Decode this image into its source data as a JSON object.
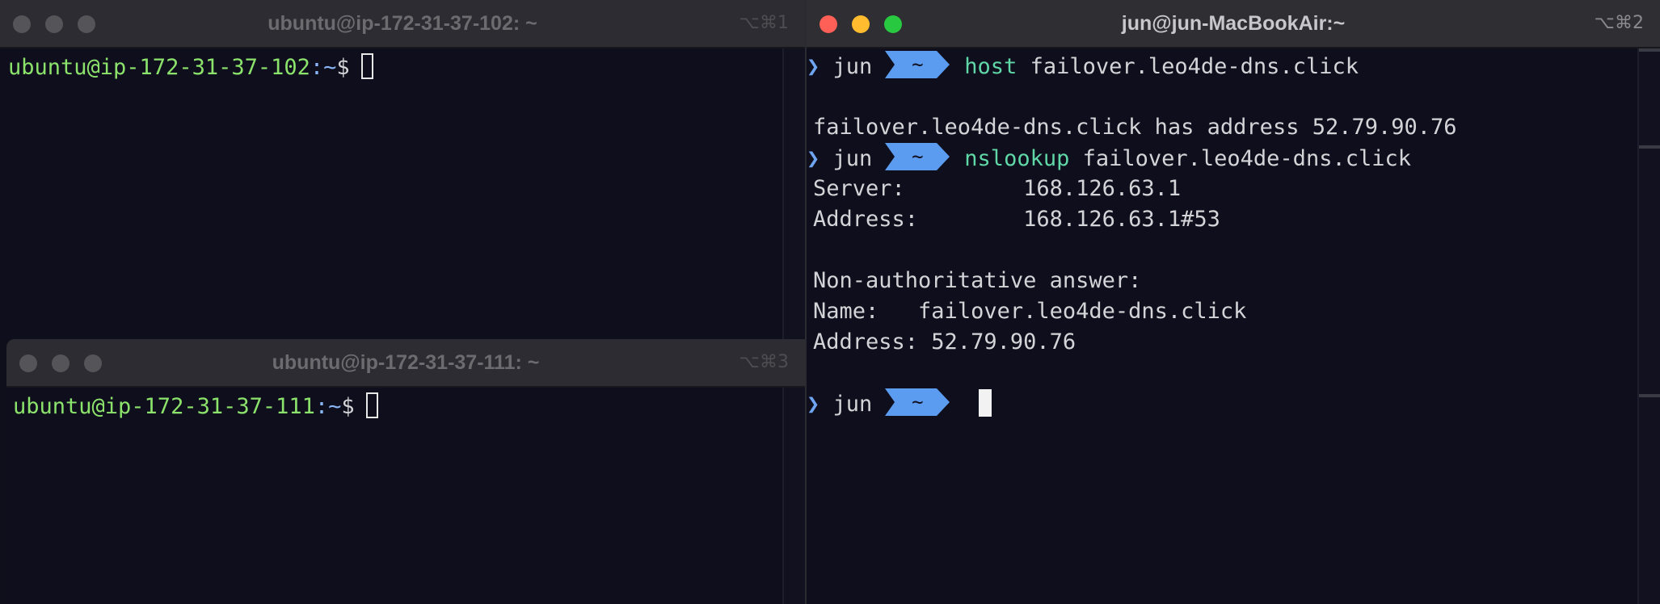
{
  "windows": {
    "top_left": {
      "title": "ubuntu@ip-172-31-37-102: ~",
      "shortcut": "⌥⌘1",
      "prompt_user": "ubuntu@ip-172-31-37-102",
      "prompt_path": ":~",
      "prompt_symbol": "$"
    },
    "bottom_left": {
      "title": "ubuntu@ip-172-31-37-111: ~",
      "shortcut": "⌥⌘3",
      "prompt_user": "ubuntu@ip-172-31-37-111",
      "prompt_path": ":~",
      "prompt_symbol": "$"
    },
    "right": {
      "title": "jun@jun-MacBookAir:~",
      "shortcut": "⌥⌘2",
      "prompt": {
        "user": "jun",
        "dir": "~"
      },
      "lines": [
        {
          "type": "prompt",
          "cmd": "host",
          "args": "failover.leo4de-dns.click"
        },
        {
          "type": "blank"
        },
        {
          "type": "out",
          "text": "failover.leo4de-dns.click has address 52.79.90.76"
        },
        {
          "type": "prompt",
          "cmd": "nslookup",
          "args": "failover.leo4de-dns.click"
        },
        {
          "type": "out",
          "text": "Server:\t\t168.126.63.1"
        },
        {
          "type": "out",
          "text": "Address:\t168.126.63.1#53"
        },
        {
          "type": "blank"
        },
        {
          "type": "out",
          "text": "Non-authoritative answer:"
        },
        {
          "type": "out",
          "text": "Name:\tfailover.leo4de-dns.click"
        },
        {
          "type": "out",
          "text": "Address: 52.79.90.76"
        },
        {
          "type": "blank"
        },
        {
          "type": "prompt_cursor"
        }
      ]
    }
  },
  "colors": {
    "terminal_bg": "#0f0e1c",
    "prompt_green": "#8ce36c",
    "prompt_blue": "#8ab6f6",
    "command_teal": "#5fd7a7",
    "powerline_blue": "#5b9cf0"
  }
}
